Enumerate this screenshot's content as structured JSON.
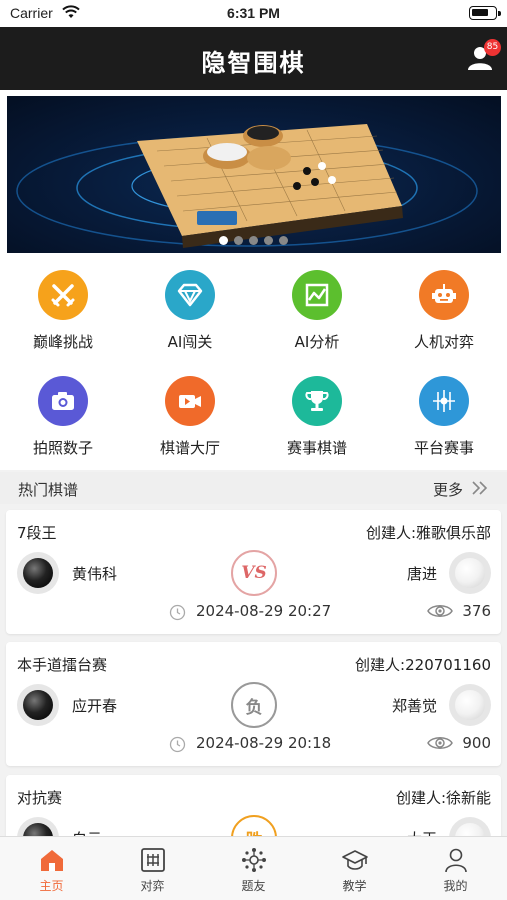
{
  "status_bar": {
    "carrier": "Carrier",
    "time": "6:31 PM"
  },
  "header": {
    "title": "隐智围棋",
    "notification_count": "85"
  },
  "menu": [
    {
      "label": "巅峰挑战",
      "icon": "crossed-swords-icon",
      "color": "#f6a21b"
    },
    {
      "label": "AI闯关",
      "icon": "diamond-icon",
      "color": "#2aa7c9"
    },
    {
      "label": "AI分析",
      "icon": "chart-icon",
      "color": "#5cbf2e"
    },
    {
      "label": "人机对弈",
      "icon": "robot-icon",
      "color": "#f17a26"
    },
    {
      "label": "拍照数子",
      "icon": "camera-icon",
      "color": "#5a59d6"
    },
    {
      "label": "棋谱大厅",
      "icon": "video-icon",
      "color": "#f06a2a"
    },
    {
      "label": "赛事棋谱",
      "icon": "trophy-icon",
      "color": "#1db99a"
    },
    {
      "label": "平台赛事",
      "icon": "crosshair-icon",
      "color": "#2e97d8"
    }
  ],
  "section": {
    "title": "热门棋谱",
    "more": "更多"
  },
  "games": [
    {
      "name": "7段王",
      "creator": "创建人:雅歌俱乐部",
      "black": "黄伟科",
      "white": "唐进",
      "result": "VS",
      "result_type": "vs",
      "date": "2024-08-29 20:27",
      "views": "376"
    },
    {
      "name": "本手道擂台赛",
      "creator": "创建人:220701160",
      "black": "应开春",
      "white": "郑善觉",
      "result": "负",
      "result_type": "lose",
      "date": "2024-08-29 20:18",
      "views": "900"
    },
    {
      "name": "对抗赛",
      "creator": "创建人:徐新能",
      "black": "白云",
      "white": "大王",
      "result": "胜",
      "result_type": "win",
      "date": "",
      "views": ""
    }
  ],
  "tabs": [
    {
      "label": "主页",
      "icon": "home-icon",
      "active": true
    },
    {
      "label": "对弈",
      "icon": "board-icon",
      "active": false
    },
    {
      "label": "题友",
      "icon": "network-icon",
      "active": false
    },
    {
      "label": "教学",
      "icon": "graduation-cap-icon",
      "active": false
    },
    {
      "label": "我的",
      "icon": "person-icon",
      "active": false
    }
  ],
  "colors": {
    "accent": "#f06a3a",
    "header_bg": "#1c1c1c",
    "badge": "#e33333"
  }
}
